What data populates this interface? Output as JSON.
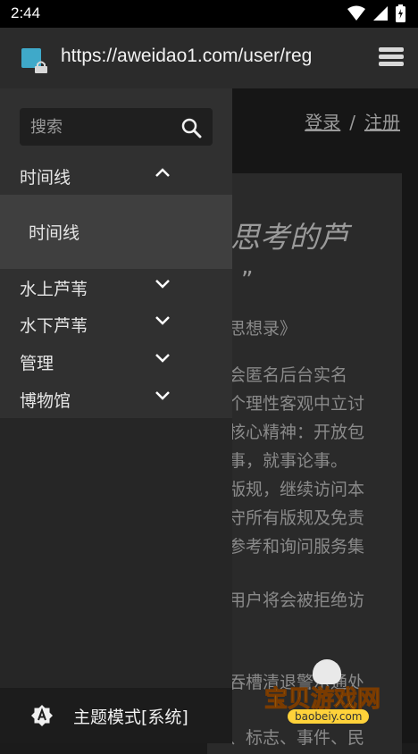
{
  "status_bar": {
    "time": "2:44"
  },
  "browser": {
    "url": "https://aweidao1.com/user/reg"
  },
  "page": {
    "login": "登录",
    "separator": "/",
    "register": "注册",
    "headline_fragment": "思考的芦",
    "quote_mark": "”",
    "subtitle_fragment": "思想录》",
    "body_lines": [
      "会匿名后台实名",
      "个理性客观中立讨",
      "核心精神：开放包",
      "事，就事论事。",
      "版规，继续访问本",
      "守所有版规及免责",
      "参考和询问服务集",
      "",
      "用户将会被拒绝访",
      "",
      "吞槽清退警示通处",
      "、标志、事件、民"
    ]
  },
  "drawer": {
    "search_placeholder": "搜索",
    "menu": [
      {
        "label": "时间线",
        "expanded": true,
        "submenu": [
          "时间线"
        ]
      },
      {
        "label": "水上芦苇",
        "expanded": false
      },
      {
        "label": "水下芦苇",
        "expanded": false
      },
      {
        "label": "管理",
        "expanded": false
      },
      {
        "label": "博物馆",
        "expanded": false
      }
    ],
    "footer_label": "主题模式[系统]"
  },
  "watermark": {
    "text": "宝贝游戏网",
    "url": "baobeiy.com"
  }
}
